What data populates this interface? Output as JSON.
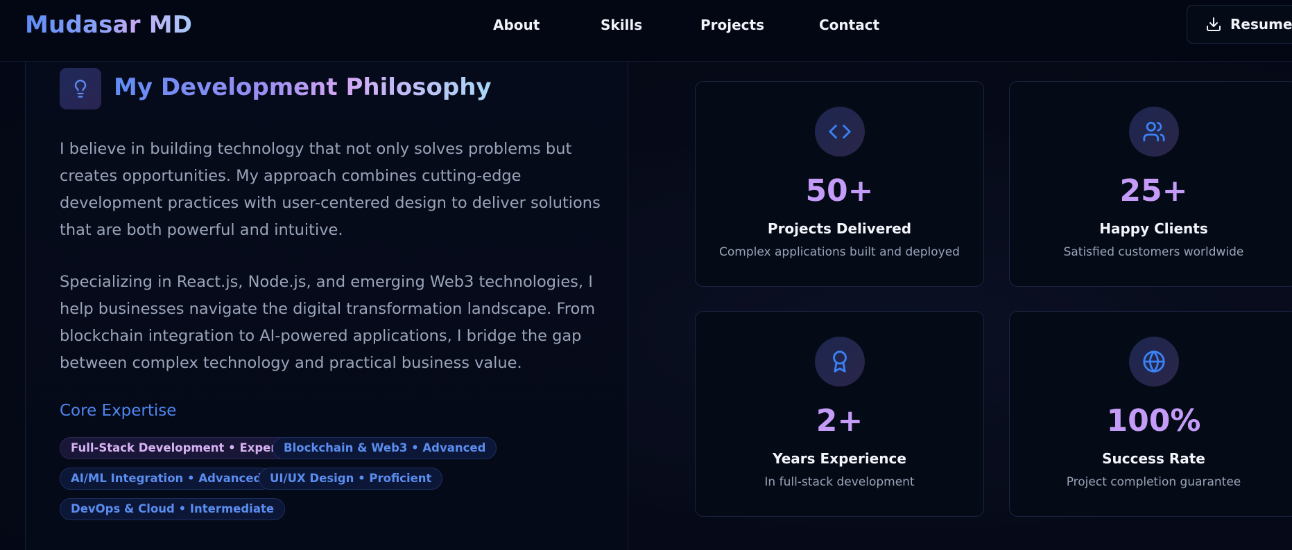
{
  "header": {
    "brand": "Mudasar MD",
    "nav": [
      {
        "label": "About"
      },
      {
        "label": "Skills"
      },
      {
        "label": "Projects"
      },
      {
        "label": "Contact"
      }
    ],
    "resume_label": "Resume",
    "resume_icon": "download-icon"
  },
  "philosophy": {
    "icon": "lightbulb-icon",
    "title": "My Development Philosophy",
    "paragraph1": "I believe in building technology that not only solves problems but creates opportunities. My approach combines cutting-edge development practices with user-centered design to deliver solutions that are both powerful and intuitive.",
    "paragraph2": "Specializing in React.js, Node.js, and emerging Web3 technologies, I help businesses navigate the digital transformation landscape. From blockchain integration to AI-powered applications, I bridge the gap between complex technology and practical business value.",
    "core_title": "Core Expertise",
    "expertise": [
      {
        "label": "Full-Stack Development • Expert"
      },
      {
        "label": "Blockchain & Web3 • Advanced"
      },
      {
        "label": "AI/ML Integration • Advanced"
      },
      {
        "label": "UI/UX Design • Proficient"
      },
      {
        "label": "DevOps & Cloud • Intermediate"
      }
    ]
  },
  "stats": [
    {
      "icon": "code-icon",
      "value": "50+",
      "label": "Projects Delivered",
      "desc": "Complex applications built and deployed"
    },
    {
      "icon": "users-icon",
      "value": "25+",
      "label": "Happy Clients",
      "desc": "Satisfied customers worldwide"
    },
    {
      "icon": "award-icon",
      "value": "2+",
      "label": "Years Experience",
      "desc": "In full-stack development"
    },
    {
      "icon": "globe-icon",
      "value": "100%",
      "label": "Success Rate",
      "desc": "Project completion guarantee"
    }
  ],
  "colors": {
    "background": "#040815",
    "accent_blue": "#4f86ee",
    "accent_purple": "#c49cf8",
    "text_muted": "#9aa4b8"
  }
}
